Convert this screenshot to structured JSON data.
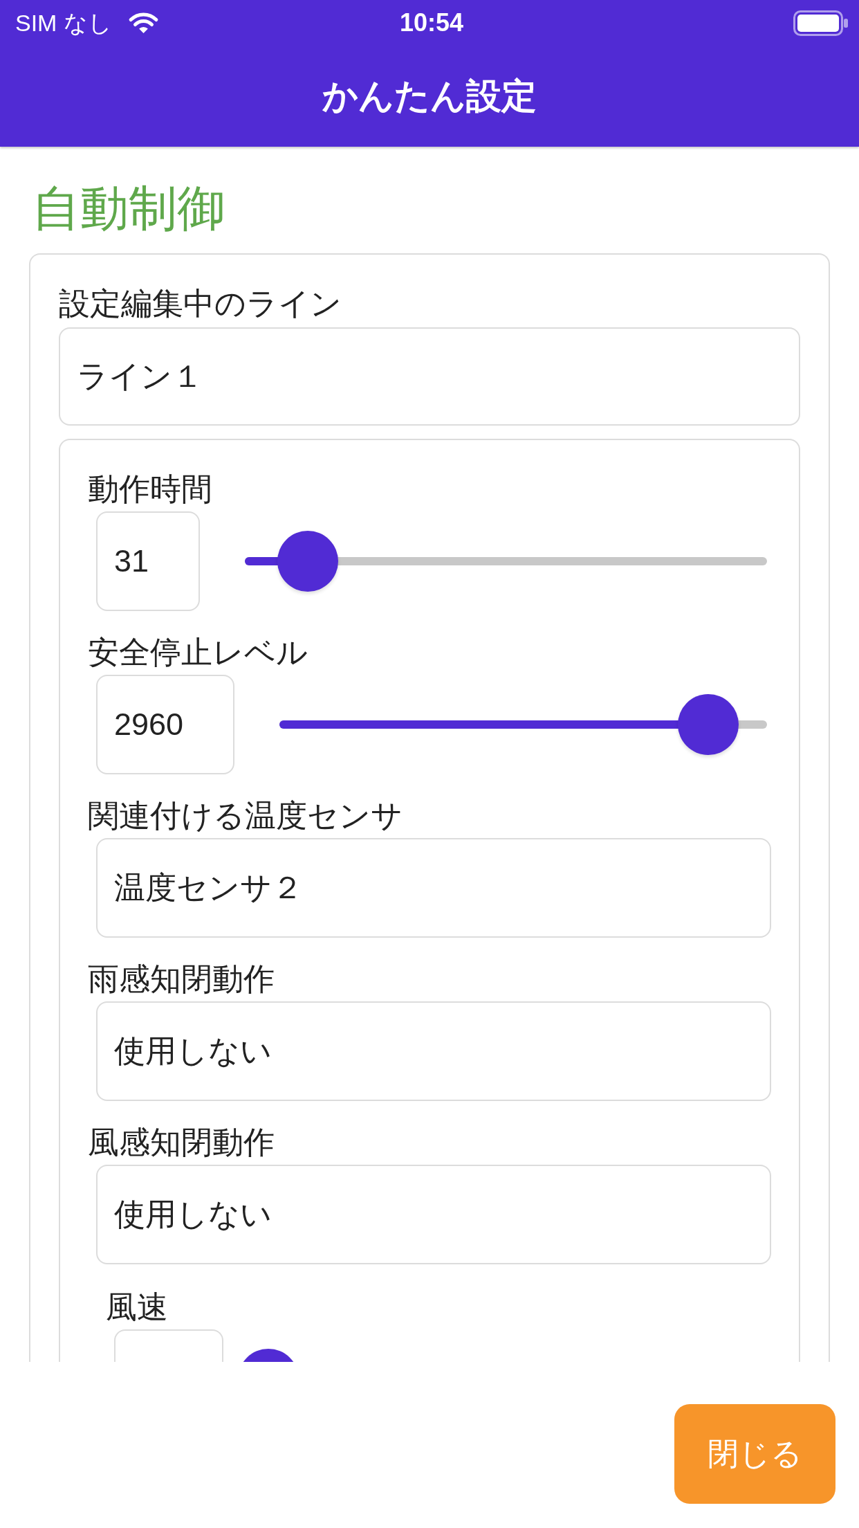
{
  "status_bar": {
    "carrier": "SIM なし",
    "time": "10:54"
  },
  "nav_bar": {
    "title": "かんたん設定"
  },
  "section": {
    "title": "自動制御",
    "line_picker": {
      "label": "設定編集中のライン",
      "value": "ライン１"
    },
    "settings": [
      {
        "kind": "slider",
        "label": "動作時間",
        "value": "31",
        "level": 0.12
      },
      {
        "kind": "slider",
        "label": "安全停止レベル",
        "value": "2960",
        "level": 0.88
      },
      {
        "kind": "picker",
        "label": "関連付ける温度センサ",
        "value": "温度センサ２"
      },
      {
        "kind": "picker",
        "label": "雨感知閉動作",
        "value": "使用しない"
      },
      {
        "kind": "picker",
        "label": "風感知閉動作",
        "value": "使用しない",
        "children": [
          {
            "kind": "slider",
            "label": "風速"
          }
        ]
      }
    ]
  },
  "close_button": {
    "label": "閉じる"
  }
}
